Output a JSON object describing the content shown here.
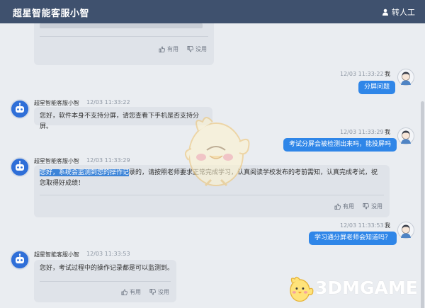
{
  "header": {
    "title": "超星智能客服小智",
    "agent_label": "转人工"
  },
  "icons": {
    "bot_avatar": "robot-icon",
    "user_avatar": "user-icon",
    "like": "thumbs-up-icon",
    "dislike": "thumbs-down-icon",
    "agent": "person-icon"
  },
  "labels": {
    "like": "有用",
    "dislike": "没用",
    "me": "我"
  },
  "bot_name": "超星智能客服小智",
  "messages": [
    {
      "role": "user",
      "time": "12/03 11:33:22",
      "text": "分屏问题"
    },
    {
      "role": "bot",
      "time": "12/03 11:33:22",
      "text": "您好，软件本身不支持分屏，请您查看下手机是否支持分屏。"
    },
    {
      "role": "user",
      "time": "12/03 11:33:29",
      "text": "考试分屏会被检测出来吗，能投屏吗"
    },
    {
      "role": "bot",
      "time": "12/03 11:33:29",
      "text_highlight": "您好，系统会监测到您的操作记",
      "text_rest": "录的，请按照老师要求正常完成学习，认真阅读学校发布的考前需知，认真完成考试，祝您取得好成绩！"
    },
    {
      "role": "user",
      "time": "12/03 11:33:53",
      "text": "学习通分屏老师会知道吗？"
    },
    {
      "role": "bot",
      "time": "12/03 11:33:53",
      "text": "您好，考试过程中的操作记录都是可以监测到。"
    }
  ],
  "watermark": "3DMGAME",
  "colors": {
    "header_bg": "#3f516e",
    "user_bubble": "#2f86e8",
    "bot_bubble": "#dfe3e9",
    "page_bg": "#eaedf1"
  }
}
